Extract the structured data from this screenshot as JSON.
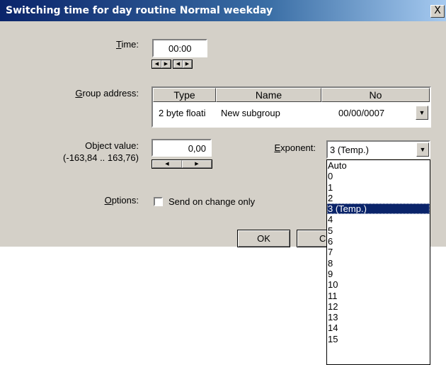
{
  "window": {
    "title": "Switching time for day routine Normal weekday",
    "close_label": "X"
  },
  "time": {
    "label_hotkey": "T",
    "label_rest": "ime:",
    "value": "00:00"
  },
  "group_address": {
    "label_hotkey": "G",
    "label_rest": "roup address:",
    "columns": [
      "Type",
      "Name",
      "No"
    ],
    "row": {
      "type": "2 byte floati",
      "name": "New subgroup",
      "no": "00/00/0007"
    }
  },
  "object_value": {
    "label": "Object value:",
    "range": "(-163,84 .. 163,76)",
    "value": "0,00"
  },
  "exponent": {
    "label_hotkey": "E",
    "label_rest": "xponent:",
    "selected": "3 (Temp.)",
    "options": [
      "Auto",
      "0",
      "1",
      "2",
      "3 (Temp.)",
      "4",
      "5",
      "6",
      "7",
      "8",
      "9",
      "10",
      "11",
      "12",
      "13",
      "14",
      "15"
    ],
    "selected_index": 4
  },
  "options": {
    "label_hotkey": "O",
    "label_rest": "ptions:",
    "send_on_change": "Send on change only",
    "checked": false
  },
  "buttons": {
    "ok": "OK",
    "cancel": "C"
  }
}
